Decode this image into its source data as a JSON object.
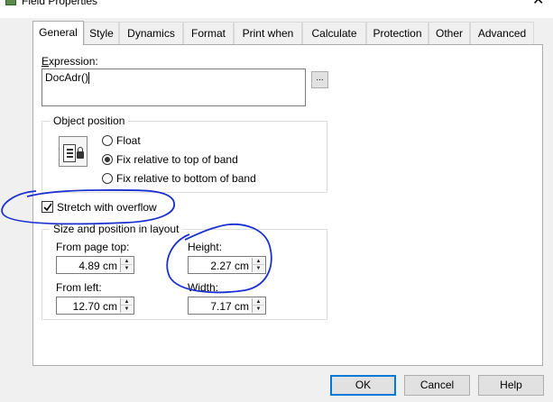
{
  "window": {
    "title": "Field Properties"
  },
  "tabs": [
    "General",
    "Style",
    "Dynamics",
    "Format",
    "Print when",
    "Calculate",
    "Protection",
    "Other",
    "Advanced"
  ],
  "active_tab": "General",
  "expression": {
    "label": "Expression:",
    "value": "DocAdr()",
    "browse_label": "..."
  },
  "object_position": {
    "title": "Object position",
    "options": [
      "Float",
      "Fix relative to top of band",
      "Fix relative to bottom of band"
    ],
    "selected": "Fix relative to top of band"
  },
  "stretch": {
    "label": "Stretch with overflow",
    "checked": true
  },
  "size_position": {
    "title": "Size and position in layout",
    "from_page_top": {
      "label": "From page top:",
      "value": "4.89 cm"
    },
    "height": {
      "label": "Height:",
      "value": "2.27 cm"
    },
    "from_left": {
      "label": "From left:",
      "value": "12.70 cm"
    },
    "width": {
      "label": "Width:",
      "value": "7.17 cm"
    }
  },
  "buttons": {
    "ok": "OK",
    "cancel": "Cancel",
    "help": "Help"
  },
  "colors": {
    "annotation": "#1a2fd0",
    "focus": "#0078d7"
  }
}
